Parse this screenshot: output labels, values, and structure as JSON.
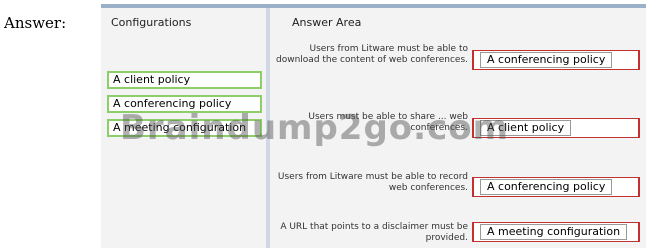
{
  "prefix": "Answer:",
  "configurations": {
    "header": "Configurations",
    "options": [
      "A client policy",
      "A conferencing policy",
      "A meeting configuration"
    ]
  },
  "answer_area": {
    "header": "Answer Area",
    "rows": [
      {
        "question": "Users from Litware must be able to download the content of web conferences.",
        "answer": "A conferencing policy"
      },
      {
        "question": "Users must be able to share ... web conferences.",
        "answer": "A client policy"
      },
      {
        "question": "Users from Litware must be able to record web conferences.",
        "answer": "A conferencing policy"
      },
      {
        "question": "A URL that points to a disclaimer must be provided.",
        "answer": "A meeting configuration"
      }
    ]
  },
  "watermark": "Braindump2go.com",
  "colors": {
    "option_border": "#8ccf6a",
    "slot_border": "#c23030",
    "panel_bg": "#f3f3f3"
  }
}
